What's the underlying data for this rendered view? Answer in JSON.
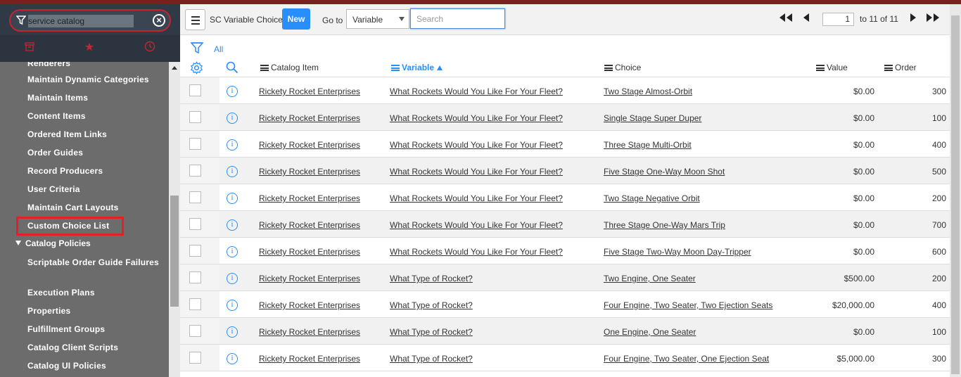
{
  "nav": {
    "filter_value": "service catalog",
    "items": [
      "Renderers",
      "Maintain Dynamic Categories",
      "Maintain Items",
      "Content Items",
      "Ordered Item Links",
      "Order Guides",
      "Record Producers",
      "User Criteria",
      "Maintain Cart Layouts",
      "Custom Choice List"
    ],
    "section": "Catalog Policies",
    "section_items": [
      "Scriptable Order Guide Failures",
      "Execution Plans",
      "Properties",
      "Fulfillment Groups",
      "Catalog Client Scripts",
      "Catalog UI Policies"
    ]
  },
  "header": {
    "title": "SC Variable Choices",
    "new_label": "New",
    "goto_label": "Go to",
    "goto_field": "Variable",
    "search_placeholder": "Search",
    "page_current": "1",
    "page_text": "to 11 of 11"
  },
  "filter": {
    "all_label": "All"
  },
  "columns": {
    "catalog_item": "Catalog Item",
    "variable": "Variable",
    "choice": "Choice",
    "value": "Value",
    "order": "Order"
  },
  "rows": [
    {
      "catalog_item": "Rickety Rocket Enterprises",
      "variable": "What Rockets Would You Like For Your Fleet?",
      "choice": "Two Stage Almost-Orbit",
      "value": "$0.00",
      "order": "300"
    },
    {
      "catalog_item": "Rickety Rocket Enterprises",
      "variable": "What Rockets Would You Like For Your Fleet?",
      "choice": "Single Stage Super Duper",
      "value": "$0.00",
      "order": "100"
    },
    {
      "catalog_item": "Rickety Rocket Enterprises",
      "variable": "What Rockets Would You Like For Your Fleet?",
      "choice": "Three Stage Multi-Orbit",
      "value": "$0.00",
      "order": "400"
    },
    {
      "catalog_item": "Rickety Rocket Enterprises",
      "variable": "What Rockets Would You Like For Your Fleet?",
      "choice": "Five Stage One-Way Moon Shot",
      "value": "$0.00",
      "order": "500"
    },
    {
      "catalog_item": "Rickety Rocket Enterprises",
      "variable": "What Rockets Would You Like For Your Fleet?",
      "choice": "Two Stage Negative Orbit",
      "value": "$0.00",
      "order": "200"
    },
    {
      "catalog_item": "Rickety Rocket Enterprises",
      "variable": "What Rockets Would You Like For Your Fleet?",
      "choice": "Three Stage One-Way Mars Trip",
      "value": "$0.00",
      "order": "700"
    },
    {
      "catalog_item": "Rickety Rocket Enterprises",
      "variable": "What Rockets Would You Like For Your Fleet?",
      "choice": "Five Stage Two-Way Moon Day-Tripper",
      "value": "$0.00",
      "order": "600"
    },
    {
      "catalog_item": "Rickety Rocket Enterprises",
      "variable": "What Type of Rocket?",
      "choice": "Two Engine, One Seater",
      "value": "$500.00",
      "order": "200"
    },
    {
      "catalog_item": "Rickety Rocket Enterprises",
      "variable": "What Type of Rocket?",
      "choice": "Four Engine, Two Seater, Two Ejection Seats",
      "value": "$20,000.00",
      "order": "400"
    },
    {
      "catalog_item": "Rickety Rocket Enterprises",
      "variable": "What Type of Rocket?",
      "choice": "One Engine, One Seater",
      "value": "$0.00",
      "order": "100"
    },
    {
      "catalog_item": "Rickety Rocket Enterprises",
      "variable": "What Type of Rocket?",
      "choice": "Four Engine, Two Seater, One Ejection Seat",
      "value": "$5,000.00",
      "order": "300"
    }
  ],
  "colors": {
    "accent": "#278efc",
    "highlight": "#e3202a",
    "nav_bg": "#303a46"
  }
}
